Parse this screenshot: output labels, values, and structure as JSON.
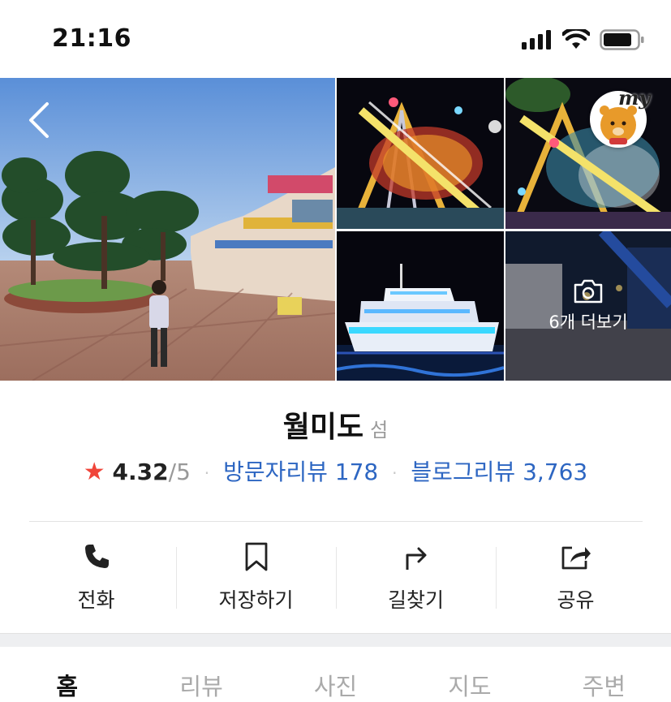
{
  "status_bar": {
    "time": "21:16"
  },
  "photos": {
    "more_label": "6개 더보기",
    "badge_text": "my"
  },
  "place": {
    "name": "월미도",
    "category": "섬"
  },
  "rating": {
    "star": "★",
    "score": "4.32",
    "max": "/5",
    "separator": "·",
    "visitor_reviews": "방문자리뷰 178",
    "blog_reviews": "블로그리뷰 3,763"
  },
  "actions": [
    {
      "label": "전화",
      "icon": "phone-icon"
    },
    {
      "label": "저장하기",
      "icon": "bookmark-icon"
    },
    {
      "label": "길찾기",
      "icon": "directions-icon"
    },
    {
      "label": "공유",
      "icon": "share-icon"
    }
  ],
  "tabs": [
    {
      "label": "홈",
      "active": true
    },
    {
      "label": "리뷰",
      "active": false
    },
    {
      "label": "사진",
      "active": false
    },
    {
      "label": "지도",
      "active": false
    },
    {
      "label": "주변",
      "active": false
    }
  ],
  "colors": {
    "accent_link": "#2d66c2",
    "star": "#f0453a"
  }
}
